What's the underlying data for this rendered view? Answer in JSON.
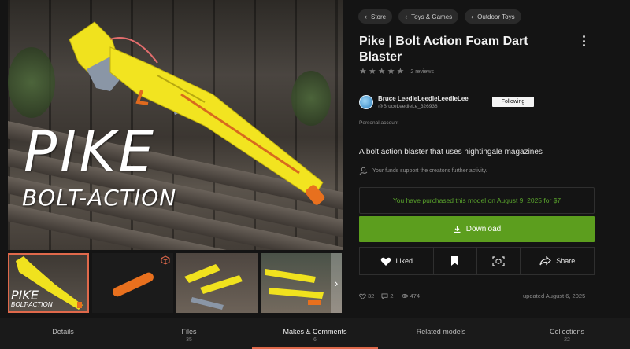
{
  "gallery": {
    "hero_title": "PIKE",
    "hero_subtitle": "BOLT-ACTION",
    "thumbnails": [
      {
        "kind": "photo",
        "active": true,
        "label_top": "PIKE",
        "label_bottom": "BOLT-ACTION"
      },
      {
        "kind": "3d-model",
        "active": false
      },
      {
        "kind": "photo",
        "active": false
      },
      {
        "kind": "photo",
        "active": false
      }
    ],
    "next_icon": "chevron-right-icon"
  },
  "breadcrumbs": [
    {
      "label": "Store"
    },
    {
      "label": "Toys & Games"
    },
    {
      "label": "Outdoor Toys"
    }
  ],
  "model": {
    "title": "Pike | Bolt Action Foam Dart Blaster",
    "reviews": "2 reviews",
    "rating_stars": 0,
    "description": "A bolt action blaster that uses nightingale magazines",
    "support_note": "Your funds support the creator's further activity."
  },
  "creator": {
    "name": "Bruce LeedleLeedleLeedleLee",
    "handle": "@BruceLeedleLe_326938",
    "follow_label": "Following",
    "account_type": "Personal account"
  },
  "purchase": {
    "message": "You have purchased this model on August 9, 2025 for $7",
    "download_label": "Download"
  },
  "actions": {
    "like_label": "Liked",
    "share_label": "Share"
  },
  "stats": {
    "likes": "32",
    "comments": "2",
    "views": "474",
    "updated": "updated August 6, 2025"
  },
  "tabs": [
    {
      "label": "Details",
      "count": ""
    },
    {
      "label": "Files",
      "count": "35"
    },
    {
      "label": "Makes & Comments",
      "count": "6",
      "active": true
    },
    {
      "label": "Related models",
      "count": ""
    },
    {
      "label": "Collections",
      "count": "22"
    }
  ],
  "colors": {
    "accent_green": "#5c9e1e",
    "purchased_text": "#59a22c",
    "active_tab_underline": "#e0694b",
    "background": "#141414"
  }
}
